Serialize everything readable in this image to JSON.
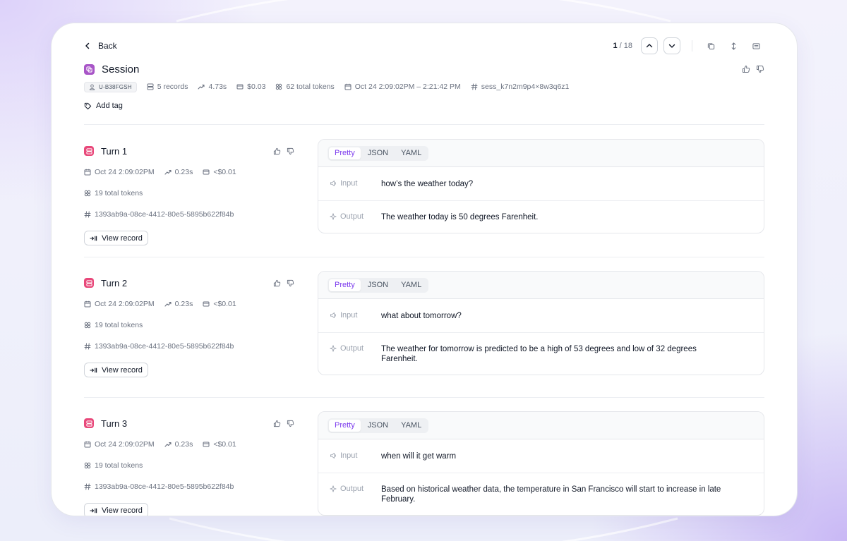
{
  "nav": {
    "back_label": "Back",
    "page_current": "1",
    "page_total": "/ 18"
  },
  "session": {
    "title": "Session",
    "user_id": "U-B38FGSH",
    "records": "5 records",
    "latency": "4.73s",
    "cost": "$0.03",
    "tokens": "62 total tokens",
    "time_range": "Oct 24 2:09:02PM – 2:21:42 PM",
    "session_id": "sess_k7n2m9p4×8w3q6z1",
    "add_tag_label": "Add tag"
  },
  "format_tabs": [
    "Pretty",
    "JSON",
    "YAML"
  ],
  "io_labels": {
    "input": "Input",
    "output": "Output"
  },
  "view_record_label": "View record",
  "turns": [
    {
      "title": "Turn 1",
      "time": "Oct 24 2:09:02PM",
      "latency": "0.23s",
      "cost": "<$0.01",
      "tokens": "19 total tokens",
      "record_id": "1393ab9a-08ce-4412-80e5-5895b622f84b",
      "input": "how’s the weather today?",
      "output": "The weather today is 50 degrees Farenheit."
    },
    {
      "title": "Turn 2",
      "time": "Oct 24 2:09:02PM",
      "latency": "0.23s",
      "cost": "<$0.01",
      "tokens": "19 total tokens",
      "record_id": "1393ab9a-08ce-4412-80e5-5895b622f84b",
      "input": "what about tomorrow?",
      "output": "The weather for tomorrow is predicted to be a high of 53 degrees and low of 32 degrees Farenheit."
    },
    {
      "title": "Turn 3",
      "time": "Oct 24 2:09:02PM",
      "latency": "0.23s",
      "cost": "<$0.01",
      "tokens": "19 total tokens",
      "record_id": "1393ab9a-08ce-4412-80e5-5895b622f84b",
      "input": "when will it get warm",
      "output": "Based on historical weather data, the temperature in San Francisco will start to increase in late February."
    }
  ],
  "colors": {
    "session_icon": "#a855c7",
    "turn_icon": "#e8487a",
    "active_tab": "#7c3aed"
  }
}
